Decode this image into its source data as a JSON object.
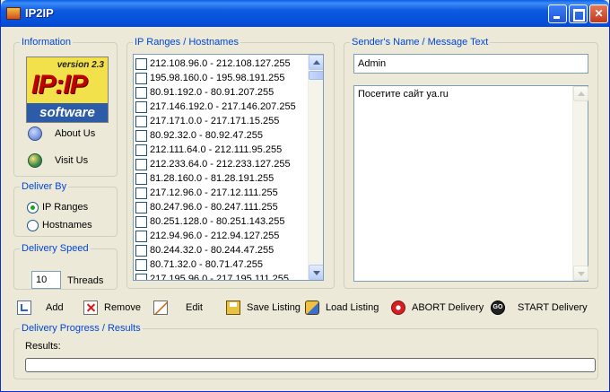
{
  "window": {
    "title": "IP2IP"
  },
  "information": {
    "legend": "Information",
    "logo": {
      "version": "version 2.3",
      "brand": "IP:IP",
      "tagline": "software"
    },
    "about_label": "About Us",
    "visit_label": "Visit Us"
  },
  "deliver_by": {
    "legend": "Deliver By",
    "options": [
      {
        "label": "IP Ranges",
        "checked": true
      },
      {
        "label": "Hostnames",
        "checked": false
      }
    ]
  },
  "delivery_speed": {
    "legend": "Delivery Speed",
    "threads_value": "10",
    "threads_label": "Threads"
  },
  "ip_ranges": {
    "legend": "IP Ranges / Hostnames",
    "items": [
      "212.108.96.0 - 212.108.127.255",
      "195.98.160.0 - 195.98.191.255",
      "80.91.192.0 - 80.91.207.255",
      "217.146.192.0 - 217.146.207.255",
      "217.171.0.0 - 217.171.15.255",
      "80.92.32.0 - 80.92.47.255",
      "212.111.64.0 - 212.111.95.255",
      "212.233.64.0 - 212.233.127.255",
      "81.28.160.0 - 81.28.191.255",
      "217.12.96.0 - 217.12.111.255",
      "80.247.96.0 - 80.247.111.255",
      "80.251.128.0 - 80.251.143.255",
      "212.94.96.0 - 212.94.127.255",
      "80.244.32.0 - 80.244.47.255",
      "80.71.32.0 - 80.71.47.255",
      "217.195.96.0 - 217.195.111.255"
    ]
  },
  "sender": {
    "legend": "Sender's Name / Message Text",
    "name_value": "Admin",
    "message_value": "Посетите сайт ya.ru"
  },
  "toolbar": {
    "add_label": "Add",
    "remove_label": "Remove",
    "edit_label": "Edit",
    "save_label": "Save Listing",
    "load_label": "Load Listing",
    "abort_label": "ABORT Delivery",
    "start_label": "START Delivery",
    "start_icon_text": "GO"
  },
  "progress": {
    "legend": "Delivery Progress / Results",
    "results_label": "Results:",
    "value": 0
  },
  "colors": {
    "legend_text": "#0046D5",
    "titlebar": "#0650DA",
    "window_bg": "#ECE9D8"
  }
}
